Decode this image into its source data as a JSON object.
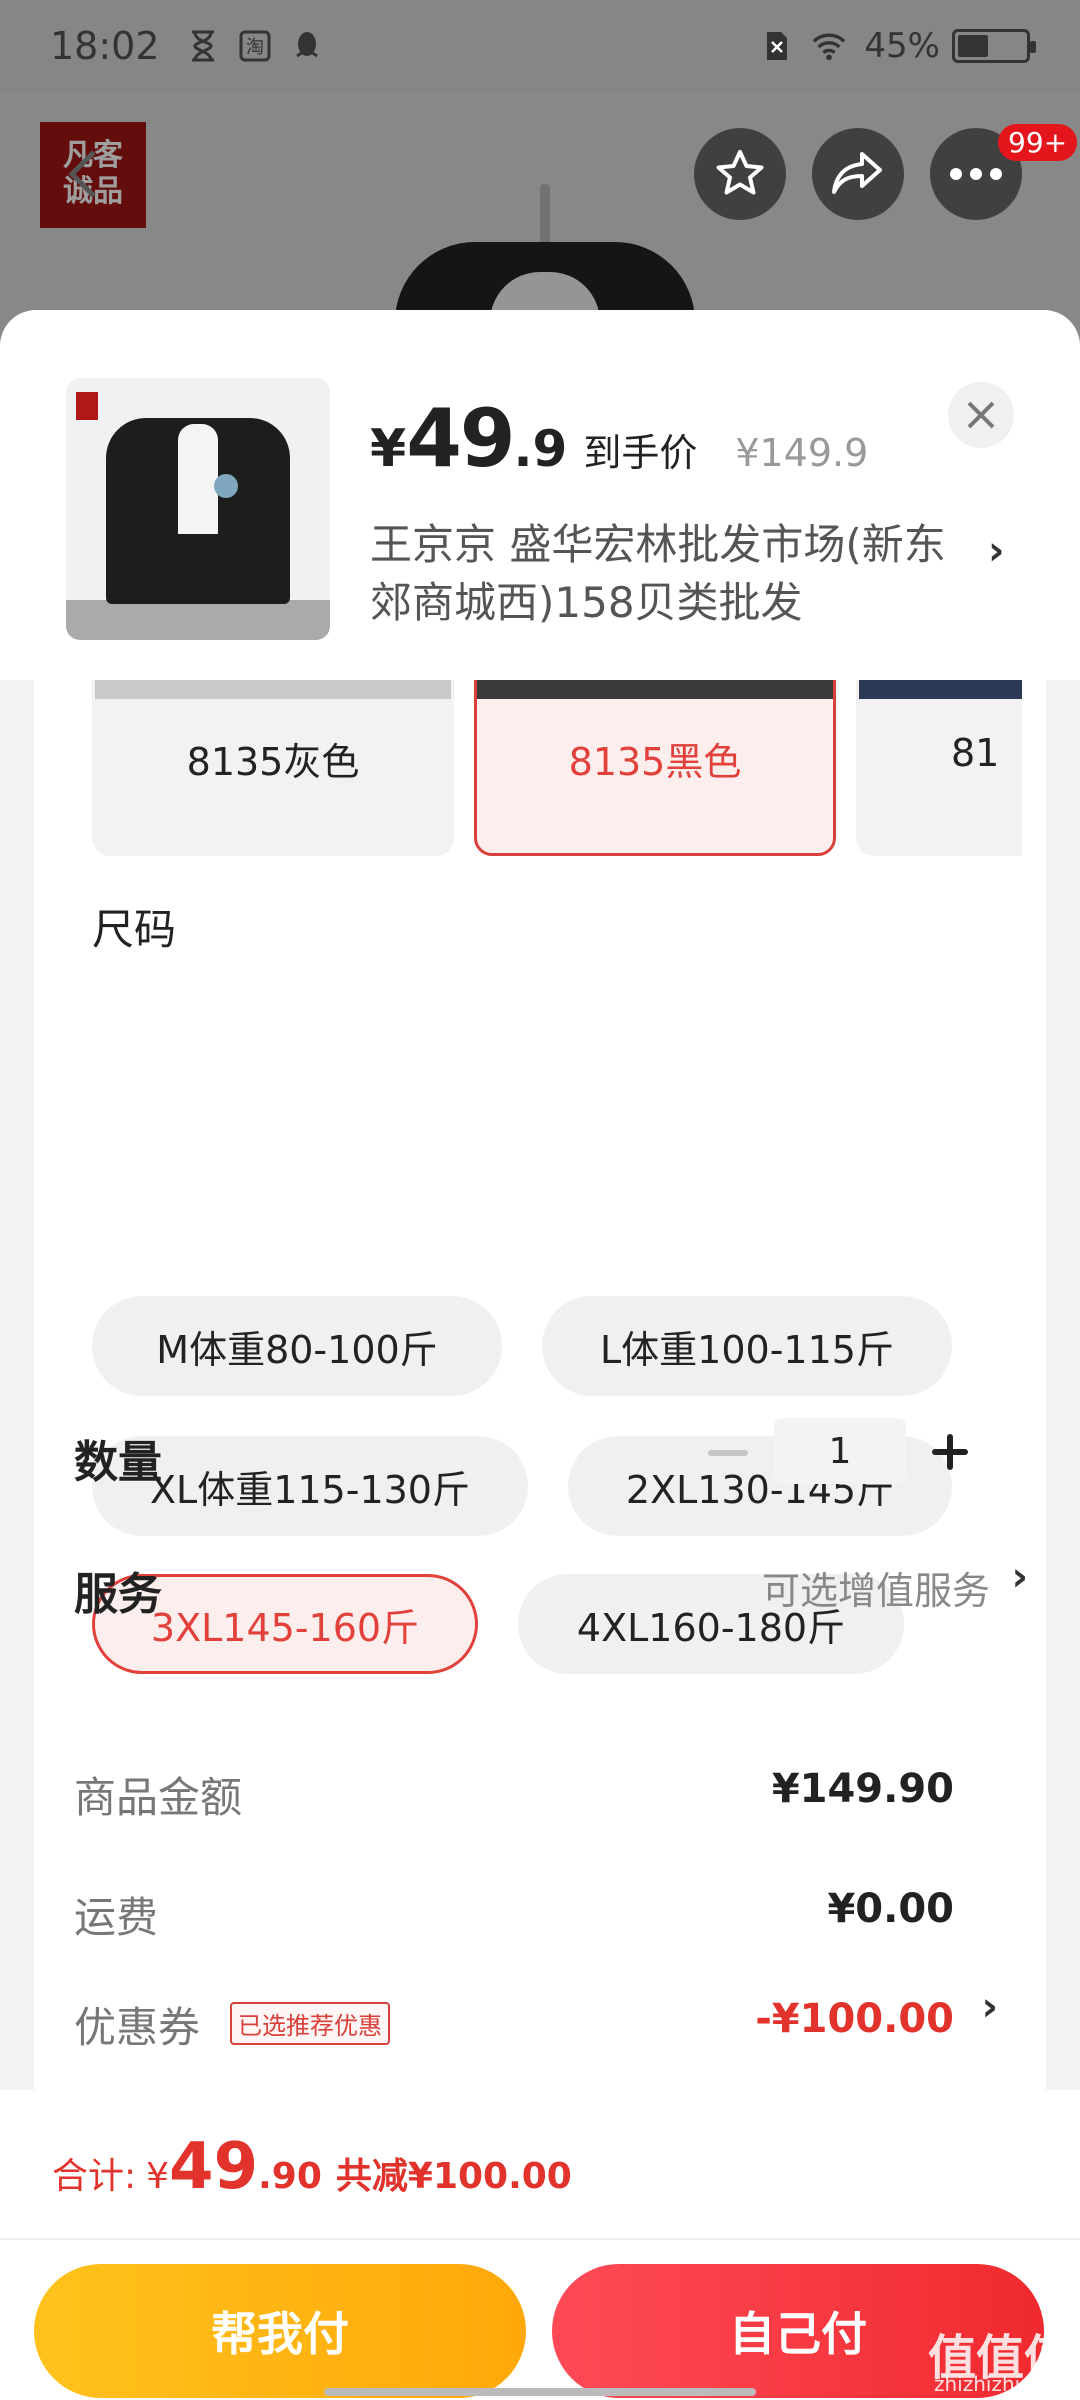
{
  "status": {
    "time": "18:02",
    "battery": "45%",
    "battery_fraction": 0.45,
    "icons": [
      "hourglass-icon",
      "taobao-icon",
      "qq-icon",
      "sim-icon",
      "wifi-icon",
      "battery-icon"
    ]
  },
  "background": {
    "logo_text": "凡客诚品",
    "badge": "99+",
    "buttons": [
      "back-icon",
      "star-icon",
      "share-icon",
      "more-icon"
    ]
  },
  "sheet": {
    "price": {
      "symbol": "¥",
      "integer": "49",
      "decimal": ".9",
      "tag": "到手价",
      "original": "¥149.9"
    },
    "address": "王京京  盛华宏林批发市场(新东郊商城西)158贝类批发",
    "colors": [
      {
        "label": "8135灰色",
        "selected": false
      },
      {
        "label": "8135黑色",
        "selected": true
      },
      {
        "label": "81",
        "selected": false
      }
    ],
    "size_title": "尺码",
    "sizes": [
      {
        "label": "M体重80-100斤",
        "selected": false
      },
      {
        "label": "L体重100-115斤",
        "selected": false
      },
      {
        "label": "XL体重115-130斤",
        "selected": false
      },
      {
        "label": "2XL130-145斤",
        "selected": false
      },
      {
        "label": "3XL145-160斤",
        "selected": true
      },
      {
        "label": "4XL160-180斤",
        "selected": false
      }
    ],
    "quantity_label": "数量",
    "quantity_value": "1",
    "service_label": "服务",
    "service_value": "可选增值服务"
  },
  "summary": {
    "goods_label": "商品金额",
    "goods_value": "¥149.90",
    "shipping_label": "运费",
    "shipping_value": "¥0.00",
    "coupon_label": "优惠券",
    "coupon_tag": "已选推荐优惠",
    "coupon_value": "-¥100.00"
  },
  "footer": {
    "total_label": "合计:",
    "total_symbol": "¥",
    "total_integer": "49",
    "total_decimal": ".90",
    "total_saved": "共减¥100.00",
    "help_pay": "帮我付",
    "self_pay": "自己付"
  },
  "watermark": {
    "main": "值值值",
    "sub": "zhizhizhi.com"
  },
  "colors": {
    "accent": "#e2322c",
    "help_btn": "#ffb414",
    "self_btn": "#f2333a"
  }
}
